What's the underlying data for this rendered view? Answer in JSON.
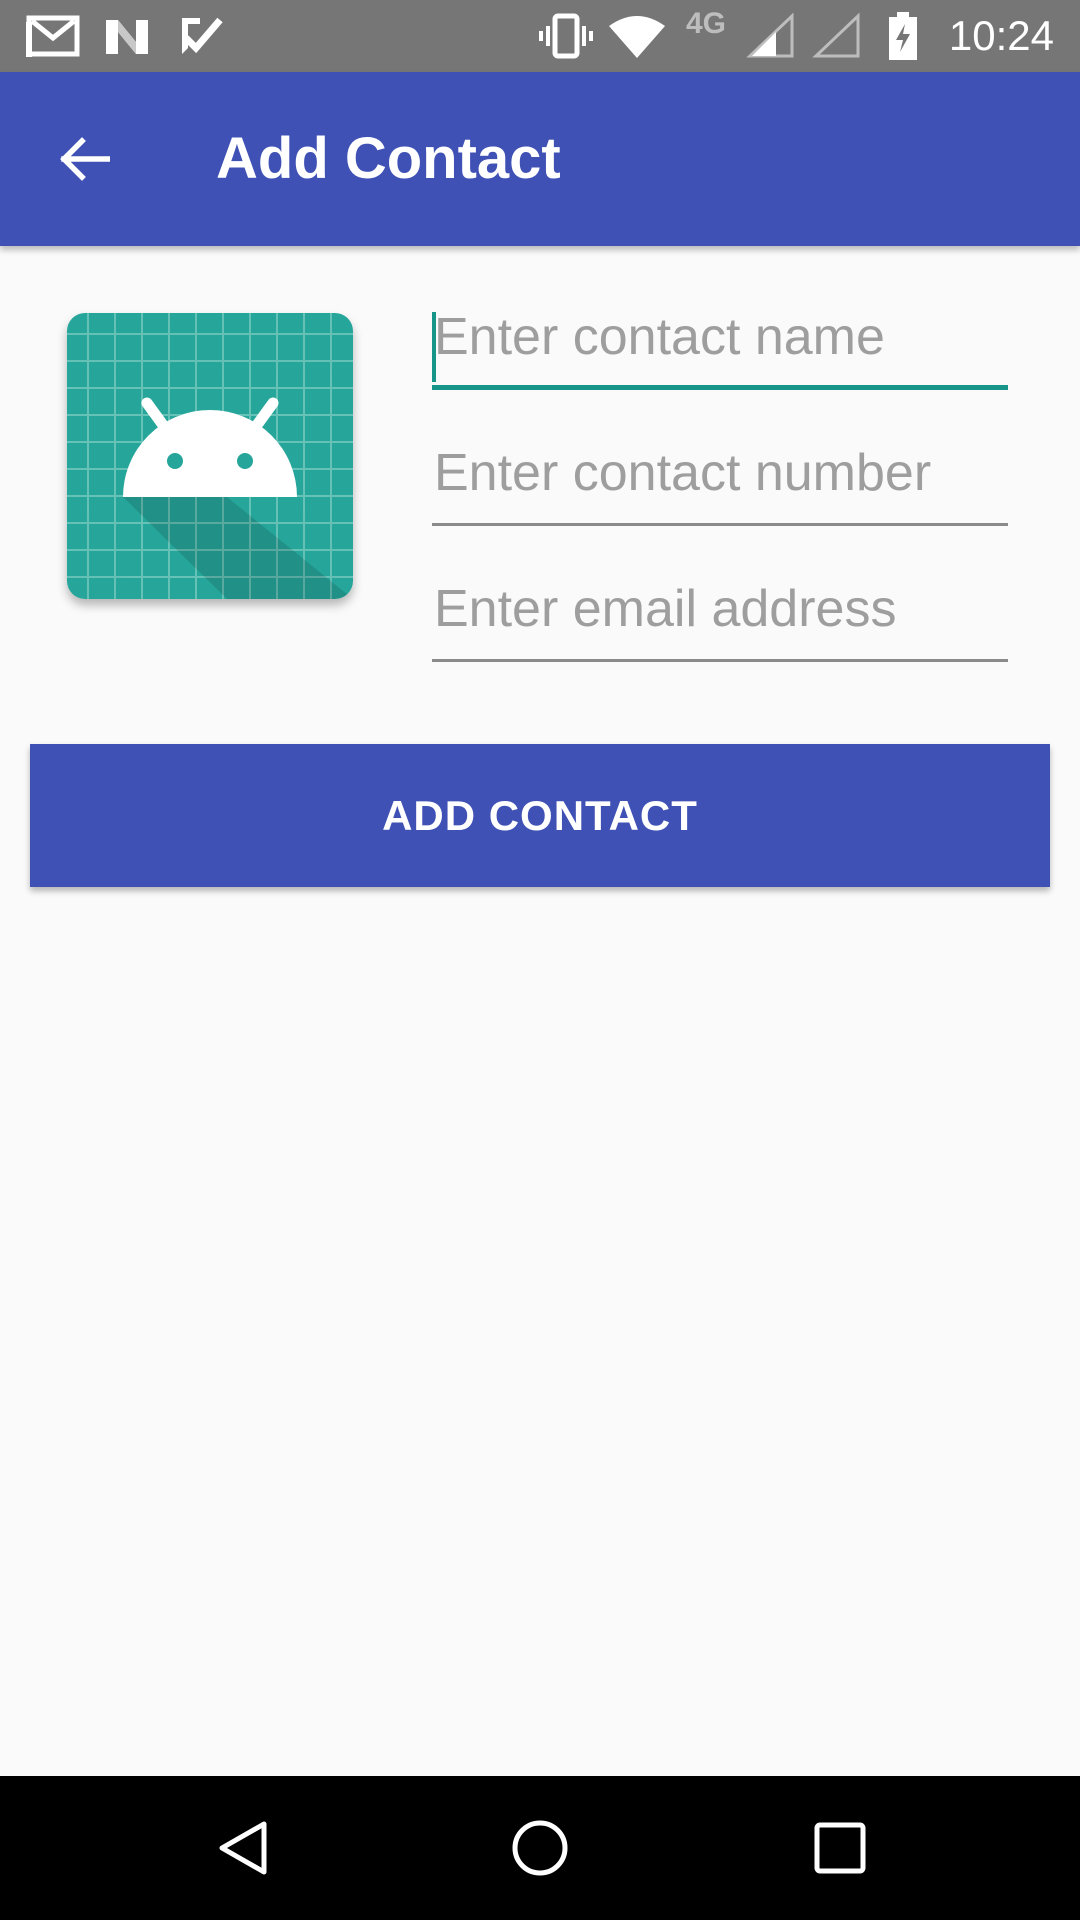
{
  "status_bar": {
    "time": "10:24",
    "network_label": "4G",
    "left_icons": [
      "gmail-icon",
      "n-app-icon",
      "task-check-icon"
    ],
    "right_icons": [
      "vibrate-icon",
      "wifi-icon",
      "signal-icon",
      "signal-empty-icon",
      "battery-charging-icon"
    ]
  },
  "app_bar": {
    "title": "Add Contact",
    "back_icon": "arrow-back-icon",
    "color": "#3f51b5"
  },
  "form": {
    "name_placeholder": "Enter contact name",
    "number_placeholder": "Enter contact number",
    "email_placeholder": "Enter email address",
    "focused_field": "name",
    "accent_color": "#169588"
  },
  "avatar": {
    "icon": "android-app-icon",
    "color": "#26a69a"
  },
  "actions": {
    "add_contact_label": "ADD CONTACT"
  },
  "nav_bar": {
    "icons": [
      "back-triangle-icon",
      "home-circle-icon",
      "recents-square-icon"
    ]
  }
}
